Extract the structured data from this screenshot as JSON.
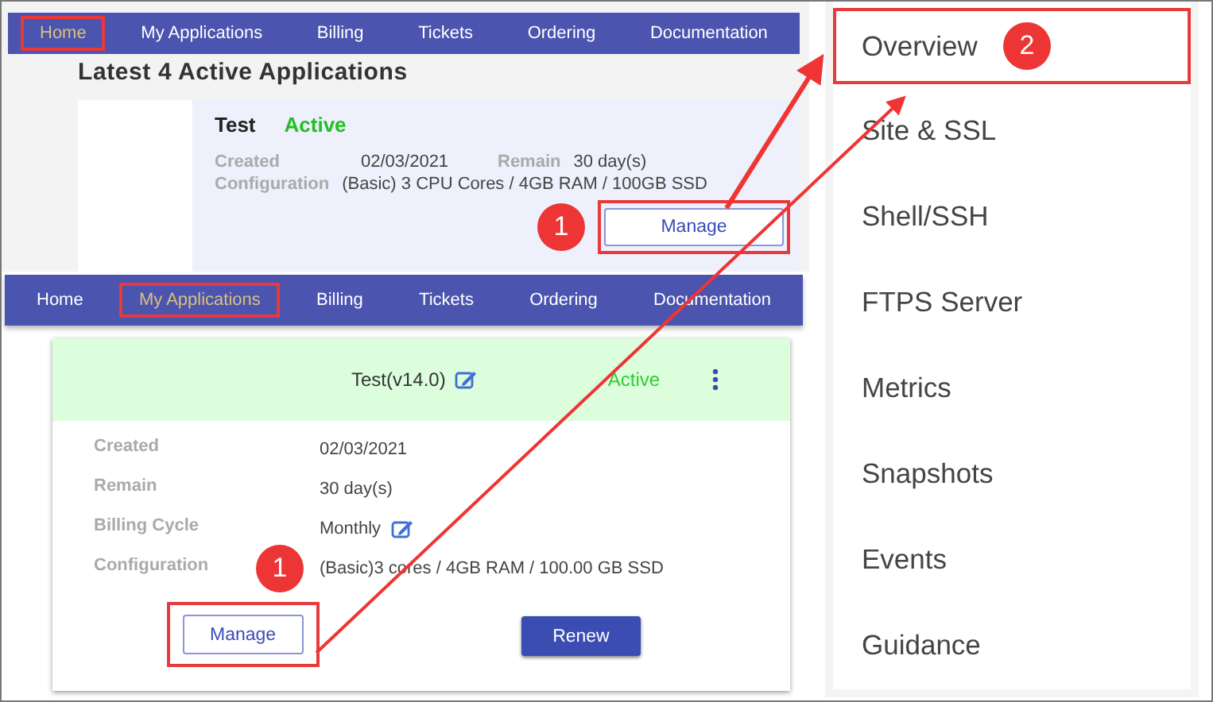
{
  "top_screen": {
    "nav": [
      {
        "label": "Home",
        "selected": true
      },
      {
        "label": "My Applications",
        "selected": false
      },
      {
        "label": "Billing",
        "selected": false
      },
      {
        "label": "Tickets",
        "selected": false
      },
      {
        "label": "Ordering",
        "selected": false
      },
      {
        "label": "Documentation",
        "selected": false
      }
    ],
    "heading": "Latest 4 Active Applications",
    "card": {
      "name": "Test",
      "status": "Active",
      "rows": [
        [
          {
            "label": "Created",
            "value": "02/03/2021"
          },
          {
            "label": "Remain",
            "value": "30 day(s)"
          }
        ],
        [
          {
            "label": "Configuration",
            "value": "(Basic) 3 CPU Cores / 4GB RAM / 100GB SSD"
          }
        ]
      ],
      "button": {
        "label": "Manage",
        "highlighted": true,
        "callout": "1"
      }
    }
  },
  "bottom_screen": {
    "nav": [
      {
        "label": "Home",
        "selected": false
      },
      {
        "label": "My Applications",
        "selected": true
      },
      {
        "label": "Billing",
        "selected": false
      },
      {
        "label": "Tickets",
        "selected": false
      },
      {
        "label": "Ordering",
        "selected": false
      },
      {
        "label": "Documentation",
        "selected": false
      }
    ],
    "card": {
      "title": "Test(v14.0)",
      "status": "Active",
      "fields": [
        {
          "label": "Created",
          "value": "02/03/2021",
          "editable": false
        },
        {
          "label": "Remain",
          "value": "30 day(s)",
          "editable": false
        },
        {
          "label": "Billing Cycle",
          "value": "Monthly",
          "editable": true
        },
        {
          "label": "Configuration",
          "value": "(Basic)3 cores / 4GB RAM / 100.00 GB SSD",
          "editable": false
        }
      ],
      "buttons": [
        {
          "label": "Manage",
          "kind": "outline",
          "highlighted": true,
          "callout": "1"
        },
        {
          "label": "Renew",
          "kind": "primary",
          "highlighted": false
        }
      ]
    }
  },
  "menu": {
    "items": [
      {
        "label": "Overview",
        "highlighted": true,
        "callout": "2"
      },
      {
        "label": "Site & SSL",
        "highlighted": false
      },
      {
        "label": "Shell/SSH",
        "highlighted": false
      },
      {
        "label": "FTPS Server",
        "highlighted": false
      },
      {
        "label": "Metrics",
        "highlighted": false
      },
      {
        "label": "Snapshots",
        "highlighted": false
      },
      {
        "label": "Events",
        "highlighted": false
      },
      {
        "label": "Guidance",
        "highlighted": false
      }
    ]
  }
}
